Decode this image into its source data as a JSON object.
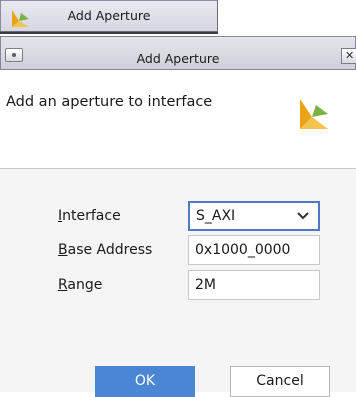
{
  "taskbar": {
    "label": "Add Aperture",
    "icon": "vivado-logo-icon"
  },
  "dialog": {
    "title": "Add Aperture",
    "header_text": "Add an aperture to interface",
    "close_glyph": "✕"
  },
  "form": {
    "interface": {
      "label_mnemonic": "I",
      "label_rest": "nterface",
      "value": "S_AXI"
    },
    "base_address": {
      "label_mnemonic": "B",
      "label_rest": "ase Address",
      "value": "0x1000_0000"
    },
    "range": {
      "label_mnemonic": "R",
      "label_rest": "ange",
      "value": "2M"
    }
  },
  "buttons": {
    "ok": "OK",
    "cancel": "Cancel"
  },
  "colors": {
    "accent": "#4a86d3",
    "focus_border": "#4f79c8",
    "logo_orange": "#e8a317",
    "logo_green": "#7cb342"
  }
}
